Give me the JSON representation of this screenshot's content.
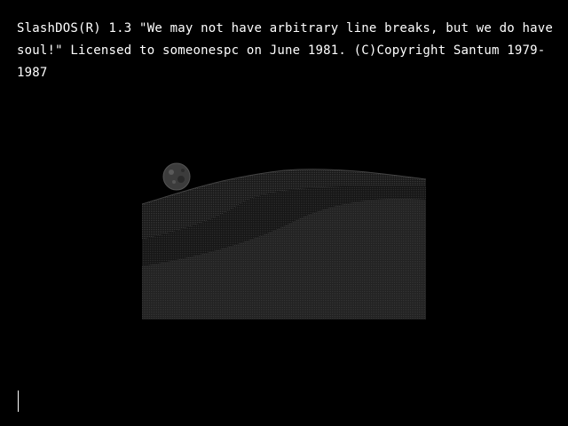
{
  "terminal": {
    "banner_line_1": "SlashDOS(R) 1.3 \"We may not have arbitrary line breaks, but we do have soul!\" Licensed to someonespc on June 1981. (C)Copyright Santum 1979-1987",
    "cursor": "|"
  },
  "colors": {
    "background": "#000000",
    "text": "#ffffff"
  },
  "image": {
    "subject": "moon-over-dunes-picture"
  }
}
